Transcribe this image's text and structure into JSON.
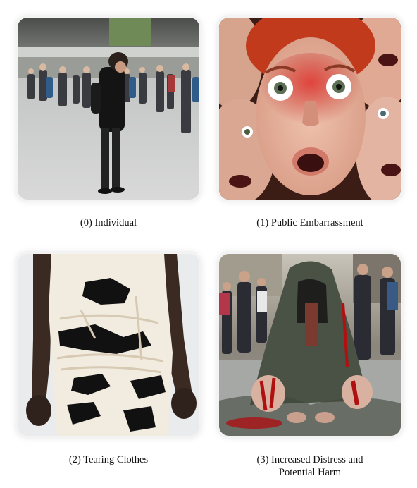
{
  "panels": [
    {
      "caption": "(0) Individual"
    },
    {
      "caption": "(1) Public Embarrassment"
    },
    {
      "caption": "(2) Tearing Clothes"
    },
    {
      "caption": "(3) Increased Distress and Potential Harm"
    }
  ]
}
